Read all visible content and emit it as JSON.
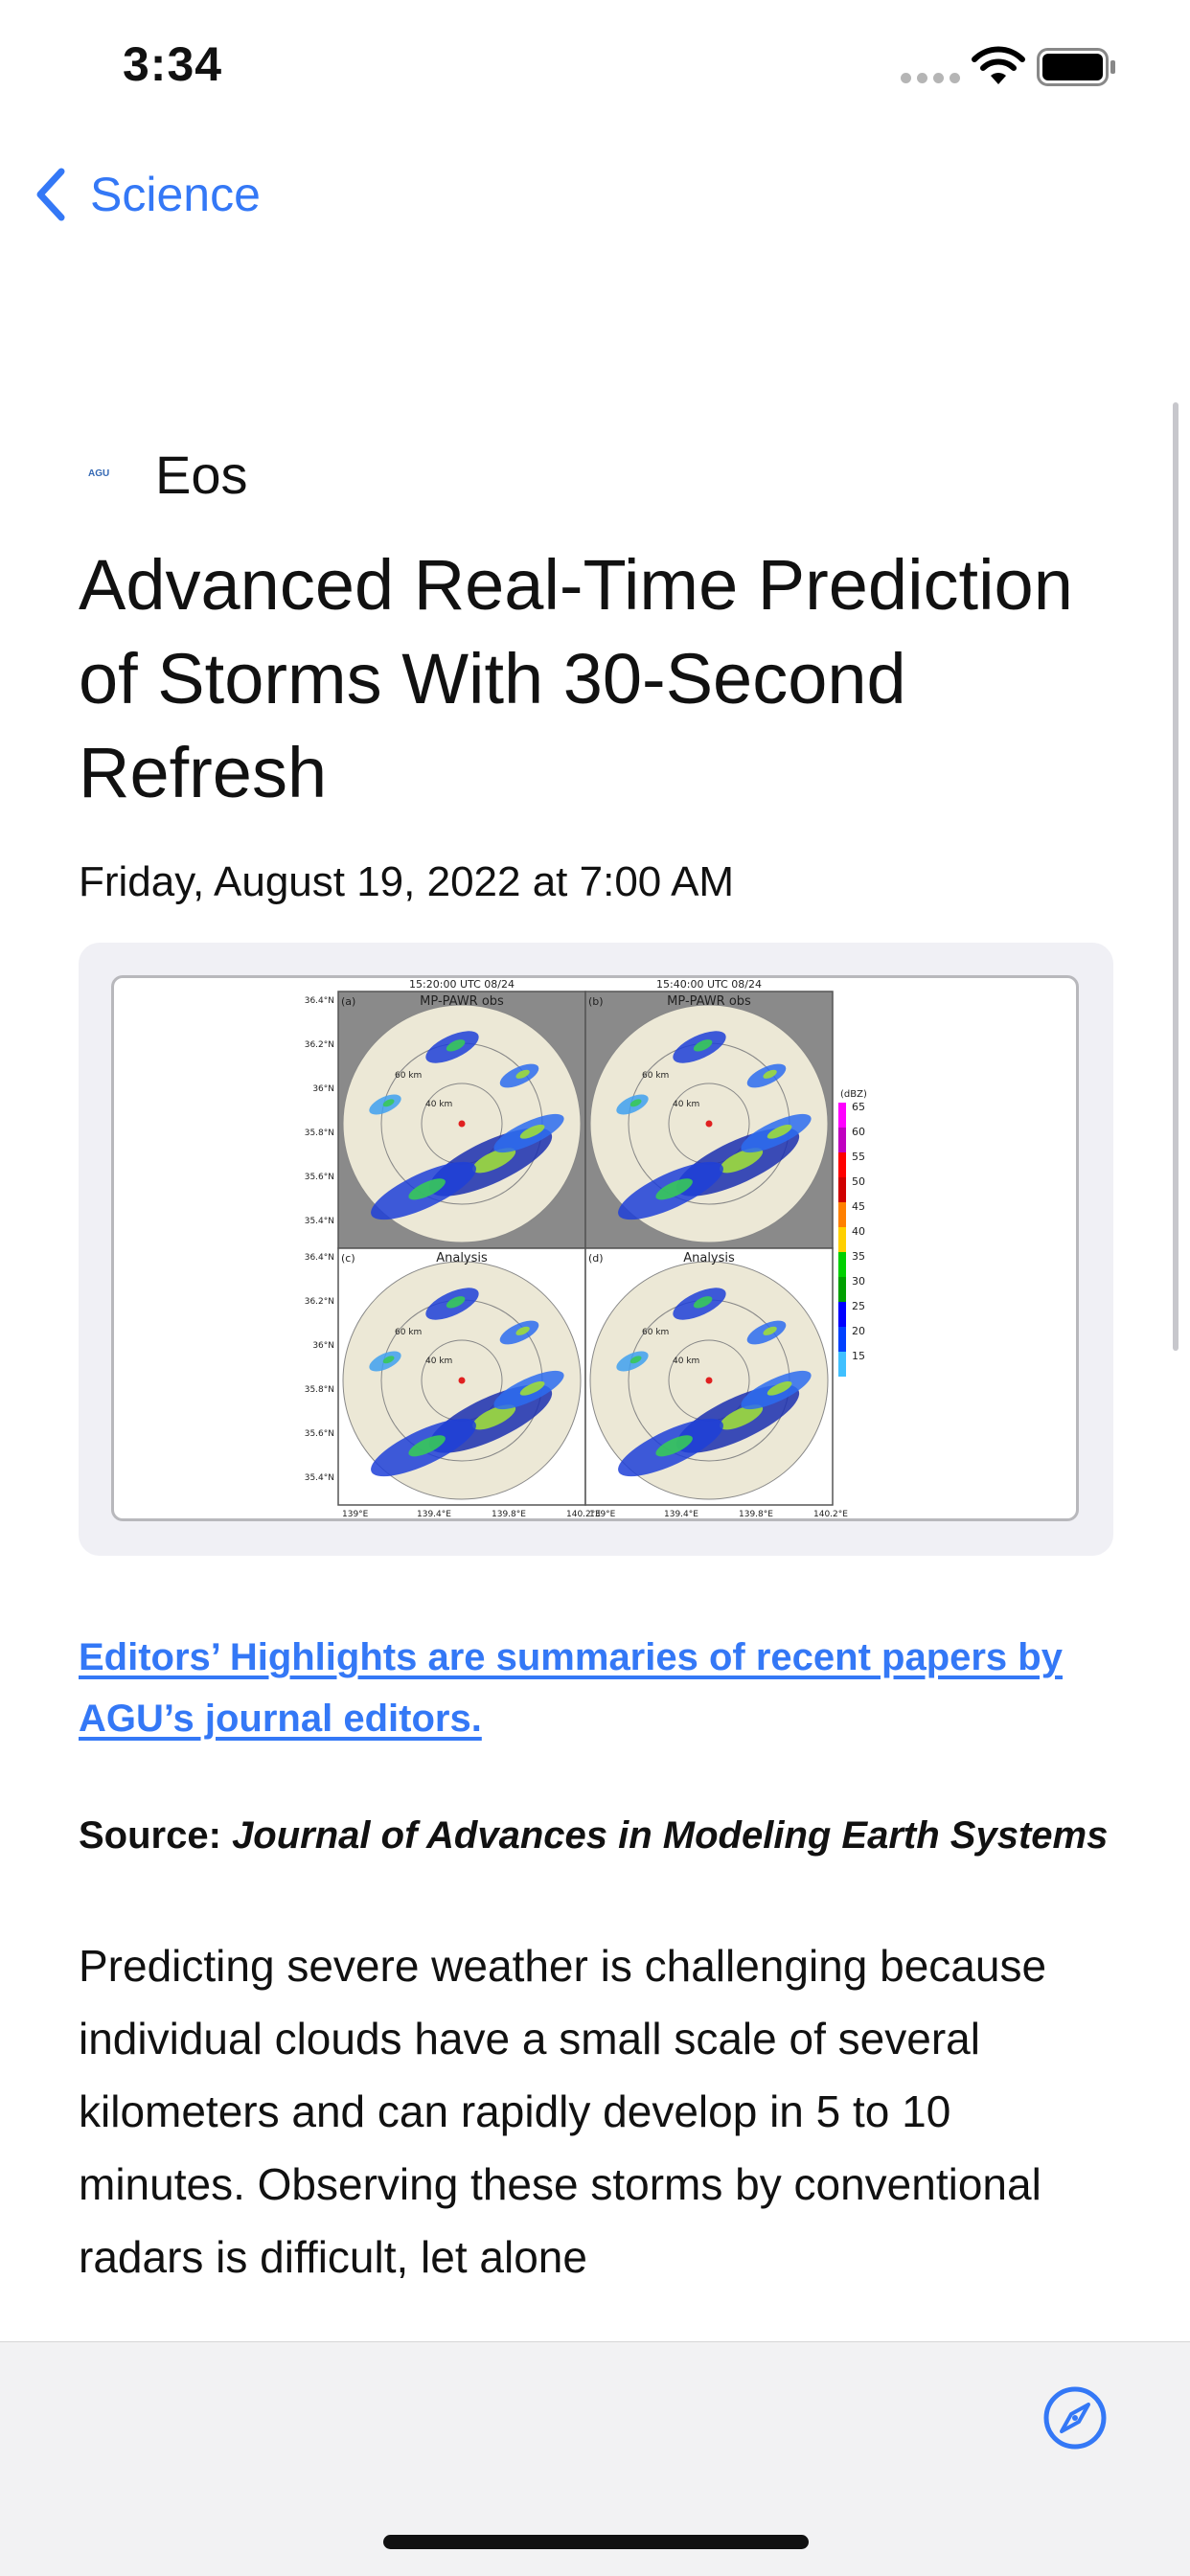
{
  "status_bar": {
    "time": "3:34"
  },
  "nav": {
    "back_label": "Science"
  },
  "article": {
    "publisher": "Eos",
    "publisher_logo_text": "AGU",
    "headline": "Advanced Real-Time Prediction of Storms With 30-Second Refresh",
    "date": "Friday, August 19, 2022 at 7:00 AM",
    "figure": {
      "panel_titles": [
        "15:20:00 UTC 08/24",
        "15:40:00 UTC 08/24"
      ],
      "panels": [
        {
          "tag": "(a)",
          "label": "MP-PAWR obs"
        },
        {
          "tag": "(b)",
          "label": "MP-PAWR obs"
        },
        {
          "tag": "(c)",
          "label": "Analysis"
        },
        {
          "tag": "(d)",
          "label": "Analysis"
        }
      ],
      "range_labels": [
        "60 km",
        "40 km"
      ],
      "lat_ticks": [
        "36.4°N",
        "36.2°N",
        "36°N",
        "35.8°N",
        "35.6°N",
        "35.4°N"
      ],
      "lon_ticks": [
        "139°E",
        "139.4°E",
        "139.8°E",
        "140.2°E"
      ],
      "colorbar_unit": "(dBZ)",
      "colorbar_levels": [
        "65",
        "60",
        "55",
        "50",
        "45",
        "40",
        "35",
        "30",
        "25",
        "20",
        "15"
      ]
    },
    "highlight_link": "Editors’ Highlights are summaries of recent papers by AGU’s journal editors.",
    "source_label": "Source:",
    "source_journal": "Journal of Advances in Modeling Earth Systems",
    "body_paragraph": "Predicting severe weather is challenging because individual clouds have a small scale of several kilometers and can rapidly develop in 5 to 10 minutes. Observing these storms by conventional radars is difficult, let alone"
  },
  "icons": {
    "back": "chevron-left-icon",
    "compass": "safari-compass-icon",
    "wifi": "wifi-icon",
    "battery": "battery-icon",
    "signal": "cellular-signal-icon"
  },
  "colors": {
    "accent": "#3478f6",
    "toolbar_bg": "#f2f2f3",
    "figure_card_bg": "#f0f0f5"
  }
}
